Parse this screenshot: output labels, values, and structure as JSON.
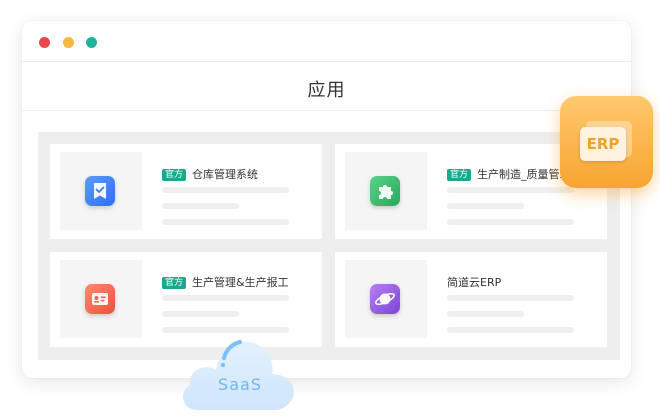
{
  "window": {
    "controls": [
      "close",
      "minimize",
      "maximize"
    ]
  },
  "header": {
    "title": "应用"
  },
  "cards": [
    {
      "badge": "官方",
      "title": "仓库管理系统",
      "icon": "checklist-icon",
      "icon_color": "#3d7ff5"
    },
    {
      "badge": "官方",
      "title": "生产制造_质量管理",
      "icon": "puzzle-icon",
      "icon_color": "#35b96b"
    },
    {
      "badge": "官方",
      "title": "生产管理&生产报工",
      "icon": "id-card-icon",
      "icon_color": "#f0684f"
    },
    {
      "badge": "",
      "title": "简道云ERP",
      "icon": "planet-icon",
      "icon_color": "#9657e4"
    }
  ],
  "erp_badge": {
    "label": "ERP"
  },
  "cloud": {
    "label": "SaaS"
  },
  "colors": {
    "badge_bg": "#1ba88f",
    "erp_orange": "#f7a531",
    "cloud_blue": "#6fb7f2"
  }
}
